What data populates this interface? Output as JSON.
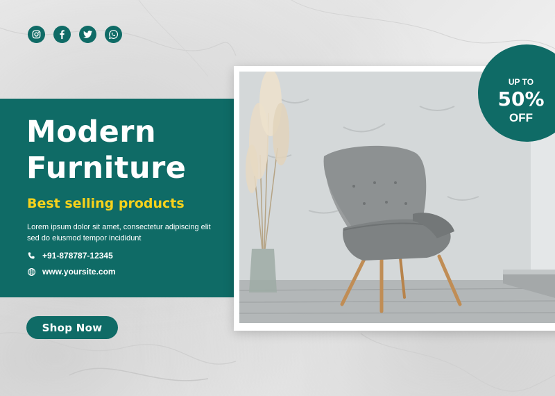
{
  "social": {
    "icons": [
      "instagram-icon",
      "facebook-icon",
      "twitter-icon",
      "whatsapp-icon"
    ]
  },
  "hero": {
    "title_line1": "Modern",
    "title_line2": "Furniture",
    "subtitle": "Best selling products",
    "description": "Lorem ipsum dolor sit amet, consectetur adipiscing elit sed do eiusmod tempor incididunt"
  },
  "contact": {
    "phone": "+91-878787-12345",
    "website": "www.yoursite.com"
  },
  "cta": {
    "label": "Shop Now"
  },
  "badge": {
    "line1": "UP TO",
    "line2": "50%",
    "line3": "OFF"
  },
  "colors": {
    "brand": "#0f6b66",
    "accent": "#f7d21b",
    "background": "#ececec"
  }
}
